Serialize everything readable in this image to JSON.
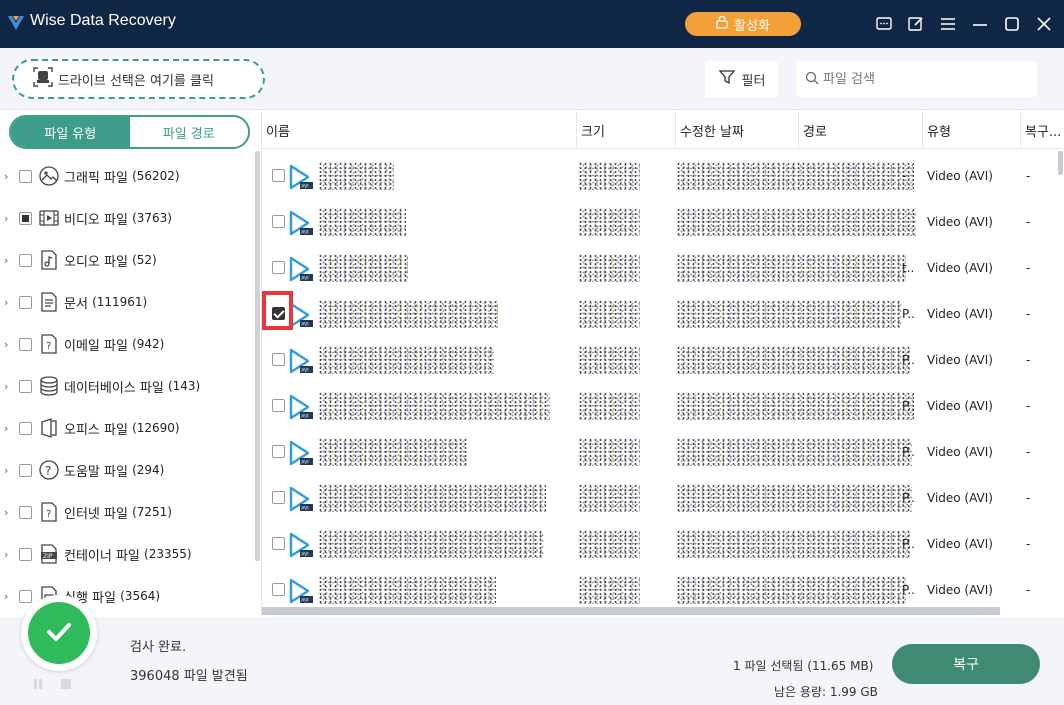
{
  "app": {
    "title": "Wise Data Recovery",
    "activate_label": "활성화"
  },
  "toolbar": {
    "drive_select_label": "드라이브 선택은 여기를 클릭",
    "filter_label": "필터",
    "search_placeholder": "파일 검색"
  },
  "left_tabs": {
    "file_type": "파일 유형",
    "file_path": "파일 경로",
    "active": "file_type"
  },
  "categories": [
    {
      "label": "그래픽 파일",
      "count": "(56202)",
      "icon": "image-icon",
      "checked": "none"
    },
    {
      "label": "비디오 파일",
      "count": "(3763)",
      "icon": "video-icon",
      "checked": "partial"
    },
    {
      "label": "오디오 파일",
      "count": "(52)",
      "icon": "audio-icon",
      "checked": "none"
    },
    {
      "label": "문서",
      "count": "(111961)",
      "icon": "document-icon",
      "checked": "none"
    },
    {
      "label": "이메일 파일",
      "count": "(942)",
      "icon": "email-icon",
      "checked": "none"
    },
    {
      "label": "데이터베이스 파일",
      "count": "(143)",
      "icon": "database-icon",
      "checked": "none"
    },
    {
      "label": "오피스 파일",
      "count": "(12690)",
      "icon": "office-icon",
      "checked": "none"
    },
    {
      "label": "도움말 파일",
      "count": "(294)",
      "icon": "help-icon",
      "checked": "none"
    },
    {
      "label": "인터넷 파일",
      "count": "(7251)",
      "icon": "internet-icon",
      "checked": "none"
    },
    {
      "label": "컨테이너 파일",
      "count": "(23355)",
      "icon": "zip-icon",
      "checked": "none"
    },
    {
      "label": "실행 파일",
      "count": "(3564)",
      "icon": "executable-icon",
      "checked": "none"
    }
  ],
  "table": {
    "headers": {
      "name": "이름",
      "size": "크기",
      "modified": "수정한 날짜",
      "path": "경로",
      "type": "유형",
      "recoverability": "복구..."
    },
    "rows": [
      {
        "checked": false,
        "path_tail": "-",
        "type": "Video (AVI)",
        "recover": "-"
      },
      {
        "checked": false,
        "path_tail": "",
        "type": "Video (AVI)",
        "recover": "-"
      },
      {
        "checked": false,
        "path_tail": "t..",
        "type": "Video (AVI)",
        "recover": "-"
      },
      {
        "checked": true,
        "path_tail": "P..",
        "type": "Video (AVI)",
        "recover": "-"
      },
      {
        "checked": false,
        "path_tail": "P..",
        "type": "Video (AVI)",
        "recover": "-"
      },
      {
        "checked": false,
        "path_tail": "P..",
        "type": "Video (AVI)",
        "recover": "-"
      },
      {
        "checked": false,
        "path_tail": "P..",
        "type": "Video (AVI)",
        "recover": "-"
      },
      {
        "checked": false,
        "path_tail": "P..",
        "type": "Video (AVI)",
        "recover": "-"
      },
      {
        "checked": false,
        "path_tail": "P..",
        "type": "Video (AVI)",
        "recover": "-"
      },
      {
        "checked": false,
        "path_tail": "P..",
        "type": "Video (AVI)",
        "recover": "-"
      }
    ]
  },
  "status": {
    "scan_status": "검사 완료.",
    "files_found": "396048 파일 발견됨",
    "selection": "1 파일 선택됨 (11.65 MB)",
    "free_space": "남은 용량: 1.99 GB",
    "recover_label": "복구"
  },
  "colors": {
    "titlebar": "#0f2744",
    "accent": "#3e9c8a",
    "activate": "#f2a139",
    "highlight": "#e8363d",
    "success": "#2fbb5c"
  }
}
